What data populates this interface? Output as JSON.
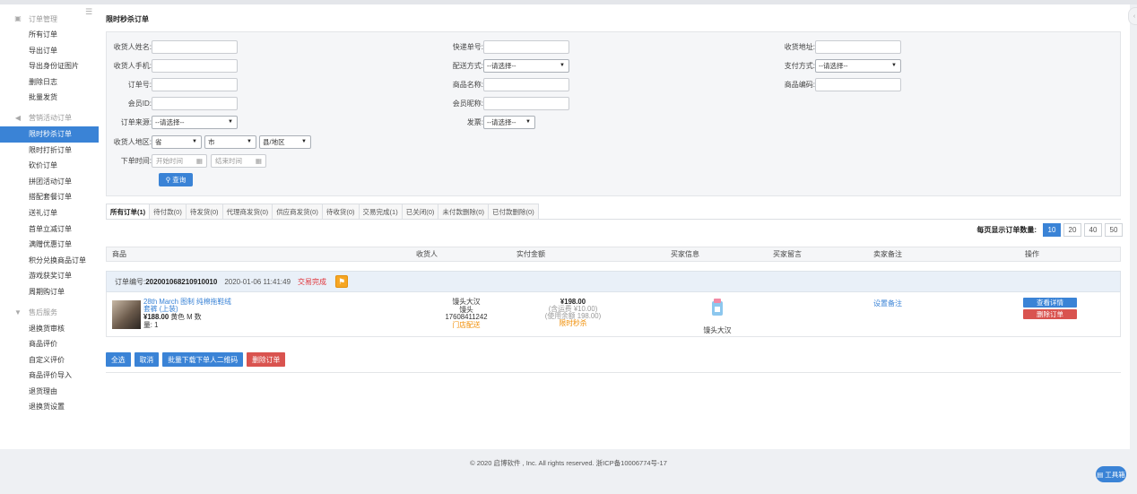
{
  "sidebar": {
    "toggle_icon": "menu-icon",
    "groups": [
      {
        "title": "订单管理",
        "icon": "clipboard-icon"
      },
      {
        "title": "营销活动订单",
        "icon": "megaphone-icon"
      },
      {
        "title": "售后服务",
        "icon": "shield-icon"
      }
    ],
    "orders": [
      "所有订单",
      "导出订单",
      "导出身份证图片",
      "删除日志",
      "批量发货"
    ],
    "marketing": [
      "限时秒杀订单",
      "限时打折订单",
      "砍价订单",
      "拼团活动订单",
      "搭配套餐订单",
      "送礼订单",
      "首单立减订单",
      "满赠优惠订单",
      "积分兑换商品订单",
      "游戏获奖订单",
      "周期购订单"
    ],
    "aftersale": [
      "退换货审核",
      "商品评价",
      "自定义评价",
      "商品评价导入",
      "退货理由",
      "退换货设置"
    ],
    "active_item": "限时秒杀订单"
  },
  "page_title": "限时秒杀订单",
  "filter": {
    "receiver_name": "收货人姓名:",
    "receiver_phone": "收货人手机:",
    "order_no": "订单号:",
    "member_id": "会员ID:",
    "order_source": "订单来源:",
    "order_source_value": "--请选择--",
    "region": "收货人地区:",
    "province": "省",
    "city": "市",
    "county": "县/地区",
    "order_time": "下单时间:",
    "start_time_placeholder": "开始时间",
    "end_time_placeholder": "结束时间",
    "express_no": "快递单号:",
    "delivery_method": "配送方式:",
    "delivery_method_value": "--请选择--",
    "product_name": "商品名称:",
    "member_nickname": "会员昵称:",
    "invoice": "发票:",
    "invoice_value": "--请选择--",
    "address": "收货地址:",
    "payment_method": "支付方式:",
    "payment_method_value": "--请选择--",
    "product_code": "商品编码:",
    "query_button": "查询"
  },
  "tabs": [
    "所有订单(1)",
    "待付款(0)",
    "待发货(0)",
    "代理商发货(0)",
    "供应商发货(0)",
    "待收货(0)",
    "交易完成(1)",
    "已关闭(0)",
    "未付款删除(0)",
    "已付款删除(0)"
  ],
  "per_page": {
    "label": "每页显示订单数量:",
    "options": [
      "10",
      "20",
      "40",
      "50"
    ],
    "selected": "10"
  },
  "table_headers": [
    "商品",
    "收货人",
    "实付金额",
    "买家信息",
    "买家留言",
    "卖家备注",
    "操作"
  ],
  "order": {
    "no_label": "订单编号:",
    "no": "202001068210910010",
    "time": "2020-01-06 11:41:49",
    "status": "交易完成",
    "product_name": "28th March 图制 纯棉拖鞋绒套裤 (上装)",
    "price": "¥188.00",
    "spec": "黄色 M 数",
    "qty": "量: 1",
    "receiver_name": "馒头大汉",
    "receiver_alias": "馒头",
    "receiver_phone": "17608411242",
    "delivery": "门店配送",
    "amount": "¥198.00",
    "shipping": "(含运费 ¥10.00)",
    "balance": "(使用余额 198.00)",
    "seckill_tag": "限时秒杀",
    "buyer_name": "馒头大汉",
    "set_note": "设置备注",
    "view_detail": "查看详情",
    "delete_order": "删除订单"
  },
  "bulk_actions": {
    "select_all": "全选",
    "cancel": "取消",
    "download_qr": "批量下载下单人二维码",
    "delete": "删除订单"
  },
  "footer": "© 2020 启博软件 , Inc. All rights reserved. 浙ICP备10006774号-17",
  "toolbox": "工具箱"
}
